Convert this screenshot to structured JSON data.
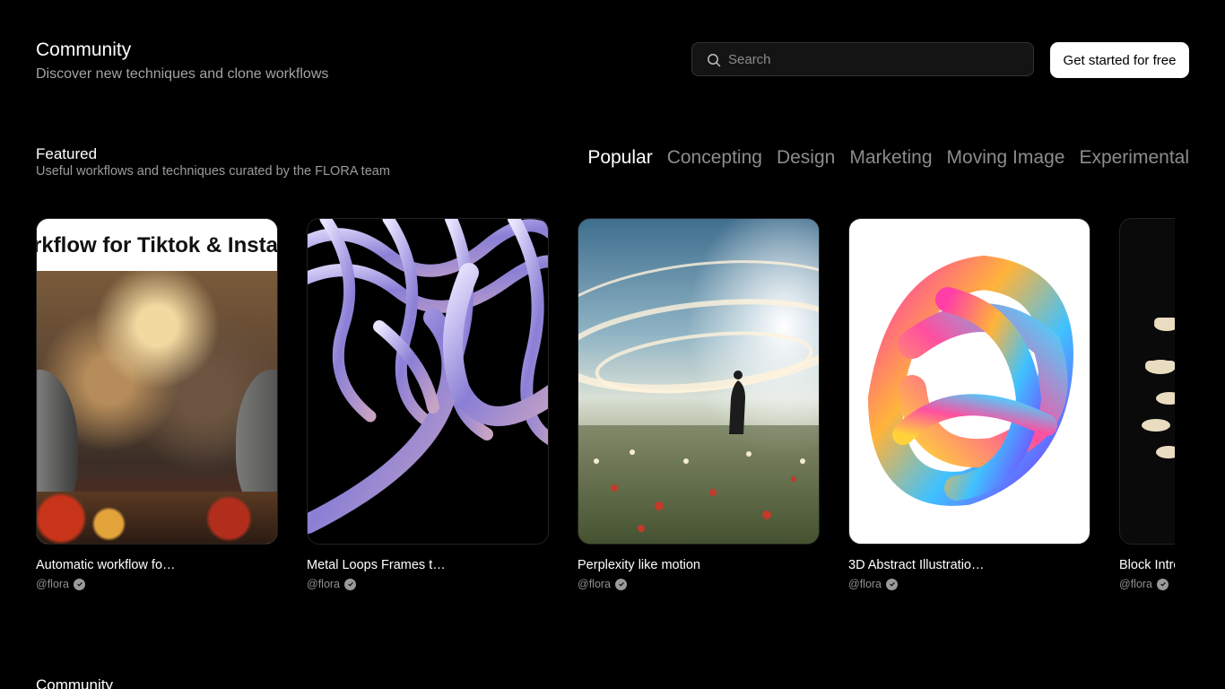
{
  "header": {
    "title": "Community",
    "subtitle": "Discover new techniques and clone workflows",
    "search_placeholder": "Search",
    "cta_label": "Get started for free"
  },
  "featured": {
    "title": "Featured",
    "subtitle": "Useful workflows and techniques curated by the FLORA team",
    "tabs": [
      {
        "label": "Popular",
        "active": true
      },
      {
        "label": "Concepting",
        "active": false
      },
      {
        "label": "Design",
        "active": false
      },
      {
        "label": "Marketing",
        "active": false
      },
      {
        "label": "Moving Image",
        "active": false
      },
      {
        "label": "Experimental",
        "active": false
      }
    ],
    "cards": [
      {
        "title": "Automatic workflow fo…",
        "author": "@flora",
        "thumb_text": "rkflow for Tiktok & Insta"
      },
      {
        "title": "Metal Loops Frames t…",
        "author": "@flora"
      },
      {
        "title": "Perplexity like motion",
        "author": "@flora"
      },
      {
        "title": "3D Abstract Illustratio…",
        "author": "@flora"
      },
      {
        "title": "Block Intro",
        "author": "@flora"
      }
    ]
  },
  "community_section": {
    "title": "Community"
  }
}
